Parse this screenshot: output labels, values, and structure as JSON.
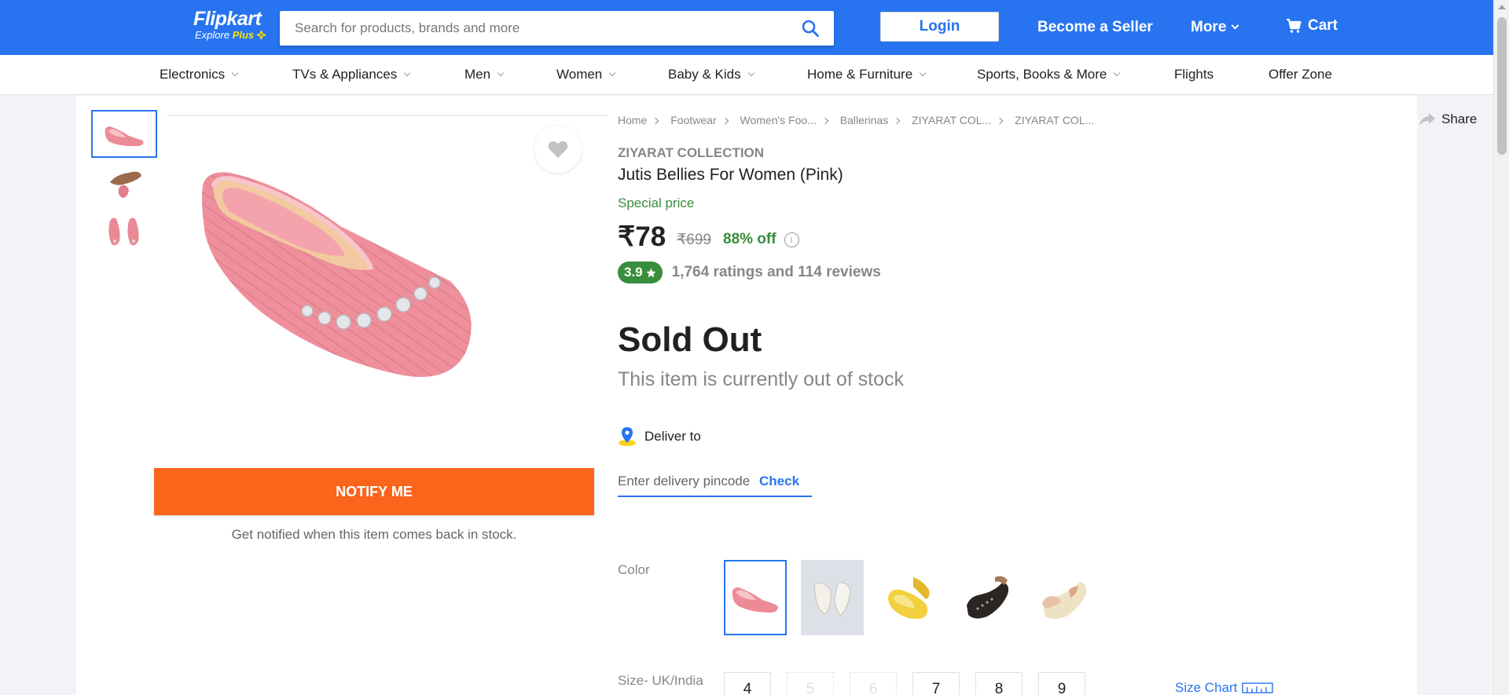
{
  "header": {
    "logo_name": "Flipkart",
    "logo_sub": "Explore",
    "logo_plus": "Plus",
    "search_placeholder": "Search for products, brands and more",
    "login_label": "Login",
    "seller_label": "Become a Seller",
    "more_label": "More",
    "cart_label": "Cart",
    "bg_color": "#2874f0",
    "plus_color": "#ffe500"
  },
  "nav": {
    "items": [
      {
        "label": "Electronics",
        "has_dropdown": true
      },
      {
        "label": "TVs & Appliances",
        "has_dropdown": true
      },
      {
        "label": "Men",
        "has_dropdown": true
      },
      {
        "label": "Women",
        "has_dropdown": true
      },
      {
        "label": "Baby & Kids",
        "has_dropdown": true
      },
      {
        "label": "Home & Furniture",
        "has_dropdown": true
      },
      {
        "label": "Sports, Books & More",
        "has_dropdown": true
      },
      {
        "label": "Flights",
        "has_dropdown": false
      },
      {
        "label": "Offer Zone",
        "has_dropdown": false
      }
    ]
  },
  "breadcrumbs": [
    "Home",
    "Footwear",
    "Women's Foo...",
    "Ballerinas",
    "ZIYARAT COL...",
    "ZIYARAT COL..."
  ],
  "share_label": "Share",
  "product": {
    "brand": "ZIYARAT COLLECTION",
    "title": "Jutis Bellies For Women  (Pink)",
    "special_label": "Special price",
    "price": "₹78",
    "mrp": "₹699",
    "discount": "88% off",
    "rating": "3.9",
    "ratings_text": "1,764 ratings and 114 reviews",
    "rating_color": "#388e3c"
  },
  "stock": {
    "title": "Sold Out",
    "subtitle": "This item is currently out of stock"
  },
  "delivery": {
    "label": "Deliver to",
    "pincode_placeholder": "Enter delivery pincode",
    "check_label": "Check"
  },
  "actions": {
    "notify_label": "NOTIFY ME",
    "notify_note": "Get notified when this item comes back in stock.",
    "notify_color": "#fb641b"
  },
  "color": {
    "label": "Color",
    "options": [
      "pink",
      "white",
      "yellow",
      "black",
      "beige"
    ],
    "selected": "pink"
  },
  "size": {
    "label": "Size- UK/India",
    "options": [
      {
        "value": "4",
        "available": true
      },
      {
        "value": "5",
        "available": false
      },
      {
        "value": "6",
        "available": false
      },
      {
        "value": "7",
        "available": true
      },
      {
        "value": "8",
        "available": true
      },
      {
        "value": "9",
        "available": true
      }
    ],
    "chart_label": "Size Chart"
  }
}
